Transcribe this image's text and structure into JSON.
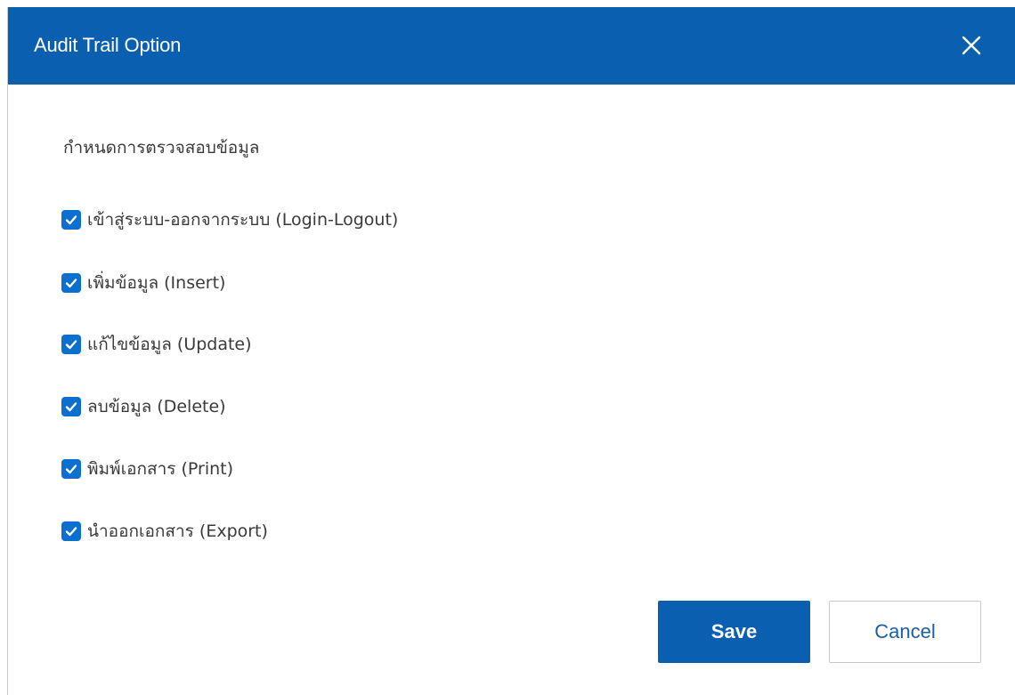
{
  "dialog": {
    "title": "Audit Trail Option",
    "close_icon": "close-icon",
    "header_color": "#0b5fb0"
  },
  "section": {
    "title": "กำหนดการตรวจสอบข้อมูล"
  },
  "options": [
    {
      "label": "เข้าสู่ระบบ-ออกจากระบบ (Login-Logout)",
      "checked": true
    },
    {
      "label": "เพิ่มข้อมูล (Insert)",
      "checked": true
    },
    {
      "label": "แก้ไขข้อมูล (Update)",
      "checked": true
    },
    {
      "label": "ลบข้อมูล (Delete)",
      "checked": true
    },
    {
      "label": "พิมพ์เอกสาร (Print)",
      "checked": true
    },
    {
      "label": "นำออกเอกสาร (Export)",
      "checked": true
    }
  ],
  "buttons": {
    "save_label": "Save",
    "cancel_label": "Cancel"
  },
  "colors": {
    "accent": "#0b5fb0",
    "checkbox": "#0b6fcf"
  }
}
